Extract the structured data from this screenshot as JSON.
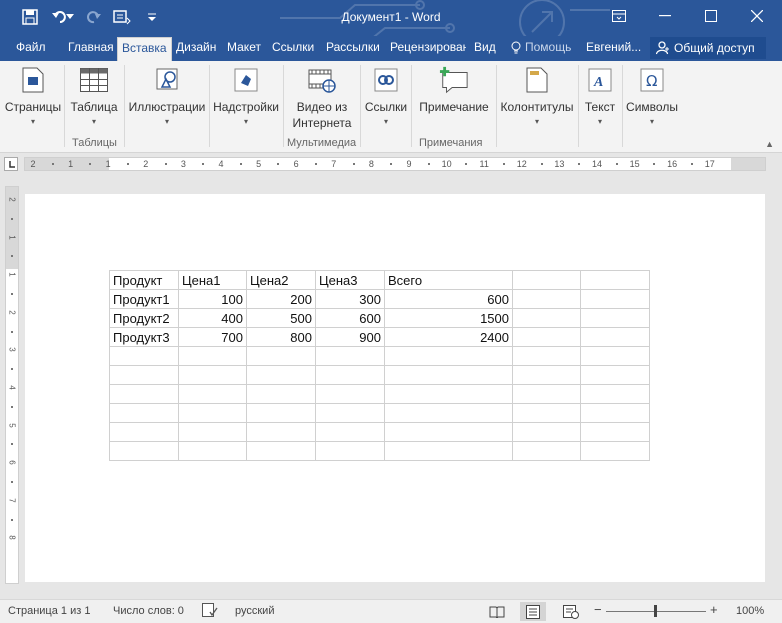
{
  "window": {
    "title": "Документ1 - Word",
    "accent_color": "#2b579a"
  },
  "quick_access": {
    "icons": [
      "save-icon",
      "undo-icon",
      "redo-icon",
      "touch-mode-icon",
      "customize-icon"
    ]
  },
  "tabs": {
    "file": "Файл",
    "home": "Главная",
    "insert": "Вставка",
    "design": "Дизайн",
    "layout": "Макет",
    "references": "Ссылки",
    "mailings": "Рассылки",
    "review": "Рецензирован",
    "view": "Вид",
    "tell_me": "Помощь",
    "user": "Евгений...",
    "share": "Общий доступ"
  },
  "ribbon": {
    "pages": "Страницы",
    "table": "Таблица",
    "illustrations": "Иллюстрации",
    "addins": "Надстройки",
    "online_video_line1": "Видео из",
    "online_video_line2": "Интернета",
    "links": "Ссылки",
    "comment": "Примечание",
    "header_footer": "Колонтитулы",
    "text": "Текст",
    "symbols": "Символы",
    "groups": {
      "tables": "Таблицы",
      "media": "Мультимедиа",
      "comments": "Примечания"
    }
  },
  "ruler": {
    "h_numbers": [
      "2",
      "1",
      "1",
      "2",
      "3",
      "4",
      "5",
      "6",
      "7",
      "8",
      "9",
      "10",
      "11",
      "12",
      "13",
      "14",
      "15",
      "16",
      "17"
    ],
    "v_numbers": [
      "2",
      "1",
      "1",
      "2",
      "3",
      "4",
      "5",
      "6",
      "7",
      "8"
    ]
  },
  "table": {
    "headers": [
      "Продукт",
      "Цена1",
      "Цена2",
      "Цена3",
      "Всего",
      "",
      ""
    ],
    "rows": [
      [
        "Продукт1",
        "100",
        "200",
        "300",
        "600",
        "",
        ""
      ],
      [
        "Продукт2",
        "400",
        "500",
        "600",
        "1500",
        "",
        ""
      ],
      [
        "Продукт3",
        "700",
        "800",
        "900",
        "2400",
        "",
        ""
      ],
      [
        "",
        "",
        "",
        "",
        "",
        "",
        ""
      ],
      [
        "",
        "",
        "",
        "",
        "",
        "",
        ""
      ],
      [
        "",
        "",
        "",
        "",
        "",
        "",
        ""
      ],
      [
        "",
        "",
        "",
        "",
        "",
        "",
        ""
      ],
      [
        "",
        "",
        "",
        "",
        "",
        "",
        ""
      ],
      [
        "",
        "",
        "",
        "",
        "",
        "",
        ""
      ]
    ]
  },
  "status": {
    "page": "Страница 1 из 1",
    "words": "Число слов: 0",
    "language": "русский",
    "zoom": "100%",
    "zoom_minus": "−",
    "zoom_plus": "+"
  }
}
